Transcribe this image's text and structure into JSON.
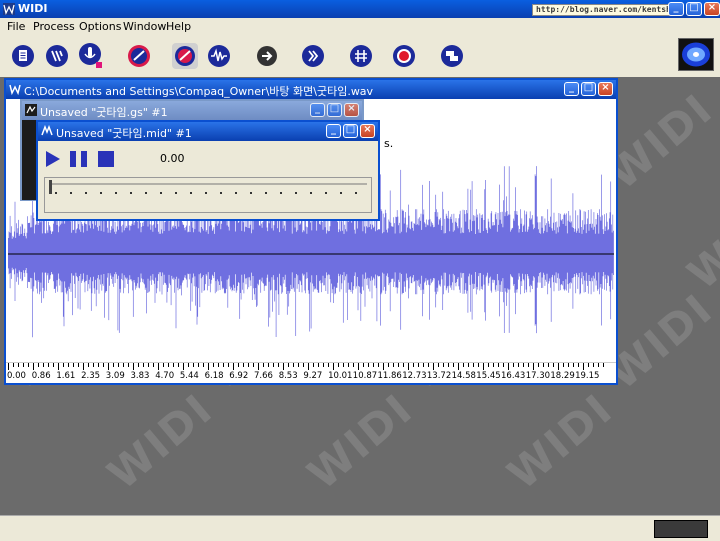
{
  "app": {
    "title": "WIDI",
    "url_tag": "http://blog.naver.com/kentsh2"
  },
  "menu": {
    "items": [
      "File",
      "Process",
      "Options",
      "Window",
      "Help"
    ]
  },
  "toolbar": {
    "buttons": [
      "new-file",
      "open-file",
      "record",
      "analyze",
      "settings",
      "waveform",
      "play-forward",
      "convert",
      "grid",
      "stop-record",
      "export"
    ]
  },
  "workspace": {
    "watermark": "WIDI",
    "background": "#6b6b6b"
  },
  "wav_window": {
    "title": "C:\\Documents and Settings\\Compaq_Owner\\바탕 화면\\굿타임.wav",
    "timeline_ticks": [
      "0.00",
      "0.86",
      "1.61",
      "2.35",
      "3.09",
      "3.83",
      "4.70",
      "5.44",
      "6.18",
      "6.92",
      "7.66",
      "8.53",
      "9.27",
      "10.01",
      "10.87",
      "11.86",
      "12.73",
      "13.72",
      "14.58",
      "15.45",
      "16.43",
      "17.30",
      "18.29",
      "19.15"
    ],
    "wave_color": "#6f6fe0"
  },
  "gs_window": {
    "title": "Unsaved \"굿타임.gs\" #1"
  },
  "mid_window": {
    "title": "Unsaved \"굿타임.mid\" #1",
    "position": "0.00"
  },
  "partial_text": "s."
}
